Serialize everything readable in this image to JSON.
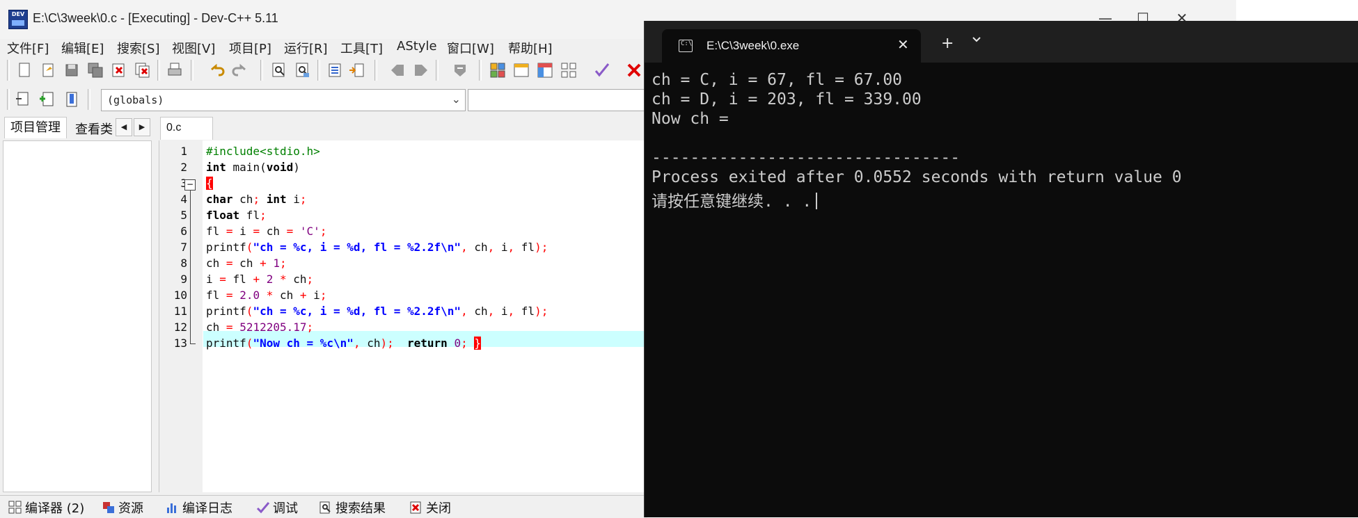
{
  "devcpp": {
    "title": "E:\\C\\3week\\0.c - [Executing] - Dev-C++ 5.11",
    "icon_label": "DEV",
    "window_controls": {
      "minimize": "—",
      "maximize": "☐",
      "close": "✕"
    },
    "menu": [
      "文件[F]",
      "编辑[E]",
      "搜索[S]",
      "视图[V]",
      "项目[P]",
      "运行[R]",
      "工具[T]",
      "AStyle",
      "窗口[W]",
      "帮助[H]"
    ],
    "globals_combo": "(globals)",
    "left_panel": {
      "tab_project": "项目管理",
      "tab_view": "查看类",
      "arrow_left": "◀",
      "arrow_right": "▶"
    },
    "editor_tab": "0.c",
    "fold_symbol": "−",
    "line_numbers": [
      "1",
      "2",
      "3",
      "4",
      "5",
      "6",
      "7",
      "8",
      "9",
      "10",
      "11",
      "12",
      "13"
    ],
    "code_lines": [
      "#include<stdio.h>",
      "int main(void)",
      "{",
      "char ch; int i;",
      "float fl;",
      "fl = i = ch = 'C';",
      "printf(\"ch = %c, i = %d, fl = %2.2f\\n\", ch, i, fl);",
      "ch = ch + 1;",
      "i = fl + 2 * ch;",
      "fl = 2.0 * ch + i;",
      "printf(\"ch = %c, i = %d, fl = %2.2f\\n\", ch, i, fl);",
      "ch = 5212205.17;",
      "printf(\"Now ch = %c\\n\", ch);  return 0; }"
    ],
    "bottom_tabs": [
      "编译器 (2)",
      "资源",
      "编译日志",
      "调试",
      "搜索结果",
      "关闭"
    ],
    "colors": {
      "highlight_line": "#ccffff",
      "brace_match": "#ff0000",
      "string": "#0000ff",
      "preprocessor": "#008000"
    }
  },
  "terminal": {
    "tab_title": "E:\\C\\3week\\0.exe",
    "tab_icon_text": "C:\\",
    "close": "✕",
    "new_tab": "+",
    "lines": [
      "ch = C, i = 67, fl = 67.00",
      "ch = D, i = 203, fl = 339.00",
      "Now ch =",
      "",
      "--------------------------------",
      "Process exited after 0.0552 seconds with return value 0",
      "请按任意键继续. . ."
    ],
    "colors": {
      "background": "#0c0c0c",
      "text": "#cccccc"
    }
  }
}
